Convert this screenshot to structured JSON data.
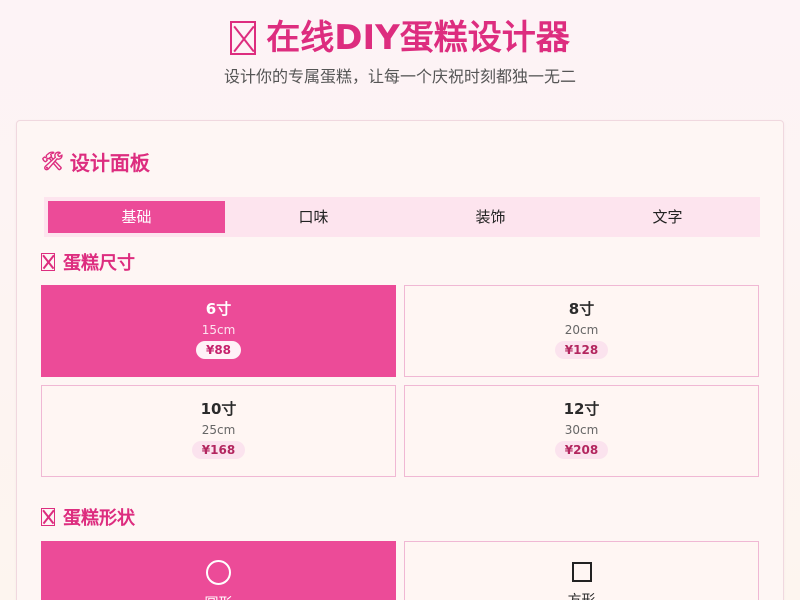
{
  "header": {
    "title": "在线DIY蛋糕设计器",
    "subtitle": "设计你的专属蛋糕，让每一个庆祝时刻都独一无二"
  },
  "panel": {
    "title": "设计面板",
    "tabs": [
      {
        "label": "基础",
        "active": true
      },
      {
        "label": "口味",
        "active": false
      },
      {
        "label": "装饰",
        "active": false
      },
      {
        "label": "文字",
        "active": false
      }
    ]
  },
  "size_section": {
    "title": "蛋糕尺寸",
    "options": [
      {
        "size": "6寸",
        "cm": "15cm",
        "price": "¥88",
        "selected": true
      },
      {
        "size": "8寸",
        "cm": "20cm",
        "price": "¥128",
        "selected": false
      },
      {
        "size": "10寸",
        "cm": "25cm",
        "price": "¥168",
        "selected": false
      },
      {
        "size": "12寸",
        "cm": "30cm",
        "price": "¥208",
        "selected": false
      }
    ]
  },
  "shape_section": {
    "title": "蛋糕形状",
    "options": [
      {
        "label": "圆形",
        "icon": "circle-icon",
        "selected": true
      },
      {
        "label": "方形",
        "icon": "square-icon",
        "selected": false
      }
    ]
  },
  "colors": {
    "accent": "#dd2d7f",
    "selected_bg": "#ec4b98",
    "tab_bar_bg": "#fde4ee"
  }
}
